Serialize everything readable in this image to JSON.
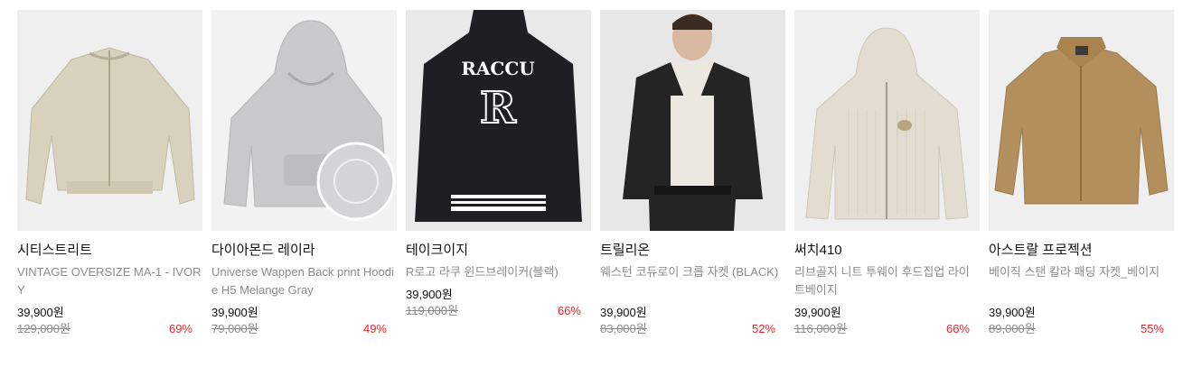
{
  "products": [
    {
      "brand": "시티스트리트",
      "name": "VINTAGE OVERSIZE MA-1 - IVORY",
      "price": "39,900원",
      "original_price": "129,000원",
      "discount": "69%",
      "thumb_color": "#efefef"
    },
    {
      "brand": "다이아몬드 레이라",
      "name": "Universe Wappen Back print Hoodie H5 Melange Gray",
      "price": "39,900원",
      "original_price": "79,000원",
      "discount": "49%",
      "thumb_color": "#f2f2f2"
    },
    {
      "brand": "테이크이지",
      "name": "R로고 라쿠 윈드브레이커(블랙)",
      "price": "39,900원",
      "original_price": "119,000원",
      "discount": "66%",
      "thumb_color": "#e9e9e9"
    },
    {
      "brand": "트릴리온",
      "name": "웨스턴 코듀로이 크롭 자켓 (BLACK)",
      "price": "39,900원",
      "original_price": "83,000원",
      "discount": "52%",
      "thumb_color": "#e7e7e7"
    },
    {
      "brand": "써치410",
      "name": "리브골지 니트 투웨이 후드집업 라이트베이지",
      "price": "39,900원",
      "original_price": "116,000원",
      "discount": "66%",
      "thumb_color": "#efefef"
    },
    {
      "brand": "아스트랄 프로젝션",
      "name": "베이직 스탠 칼라 패딩 자켓_베이지",
      "price": "39,900원",
      "original_price": "89,000원",
      "discount": "55%",
      "thumb_color": "#efefef"
    }
  ]
}
